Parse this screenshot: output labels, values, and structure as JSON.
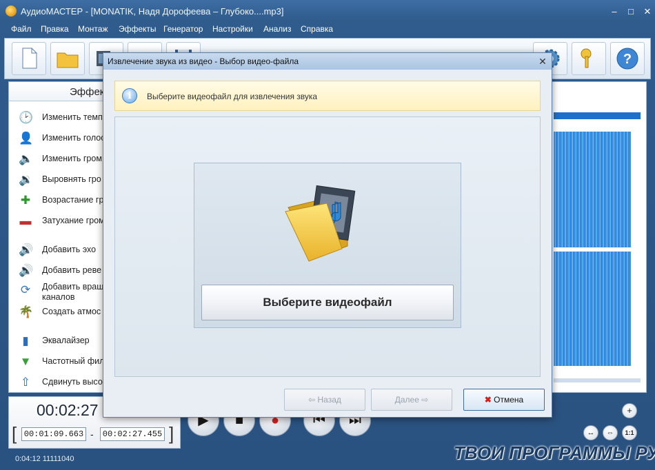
{
  "window": {
    "title": "АудиоМАСТЕР - [MONATIK, Надя Дорофеева – Глубоко....mp3]",
    "min": "–",
    "max": "□",
    "close": "✕"
  },
  "menu": [
    "Файл",
    "Правка",
    "Монтаж",
    "Эффекты",
    "Генератор",
    "Настройки",
    "Анализ",
    "Справка"
  ],
  "effects_panel": {
    "tab_label": "Эффек",
    "items": [
      {
        "label": "Изменить темп",
        "icon": "clock-icon"
      },
      {
        "label": "Изменить голос",
        "icon": "voice-icon"
      },
      {
        "label": "Изменить гром",
        "icon": "volume-icon"
      },
      {
        "label": "Выровнять гро",
        "icon": "normalize-icon"
      },
      {
        "label": "Возрастание гр",
        "icon": "fade-in-icon"
      },
      {
        "label": "Затухание гром",
        "icon": "fade-out-icon"
      },
      {
        "label": "Добавить эхо",
        "icon": "echo-icon"
      },
      {
        "label": "Добавить реве",
        "icon": "reverb-icon"
      },
      {
        "label": "Добавить враш",
        "icon": "rotate-channels-icon",
        "label2": "каналов"
      },
      {
        "label": "Создать атмос",
        "icon": "atmosphere-icon"
      },
      {
        "label": "Эквалайзер",
        "icon": "equalizer-icon"
      },
      {
        "label": "Частотный фил",
        "icon": "filter-icon"
      },
      {
        "label": "Сдвинуть высо",
        "icon": "pitch-shift-icon"
      }
    ]
  },
  "time": {
    "current": "00:02:27",
    "start": "00:01:09.663",
    "end": "00:02:27.455",
    "separator": "-",
    "bracket_left": "[",
    "bracket_right": "]"
  },
  "status": {
    "text": "0:04:12 11111040"
  },
  "watermark": "ТВОИ ПРОГРАММЫ РУ",
  "dialog": {
    "title": "Извлечение звука из видео - Выбор видео-файла",
    "close": "✕",
    "info_text": "Выберите видеофайл для извлечения звука",
    "info_icon": "i",
    "select_button": "Выберите видеофайл",
    "back_button": "Назад",
    "next_button": "Далее",
    "cancel_button": "Отмена"
  },
  "zoom": {
    "plus": "+",
    "fit": "1:1"
  }
}
